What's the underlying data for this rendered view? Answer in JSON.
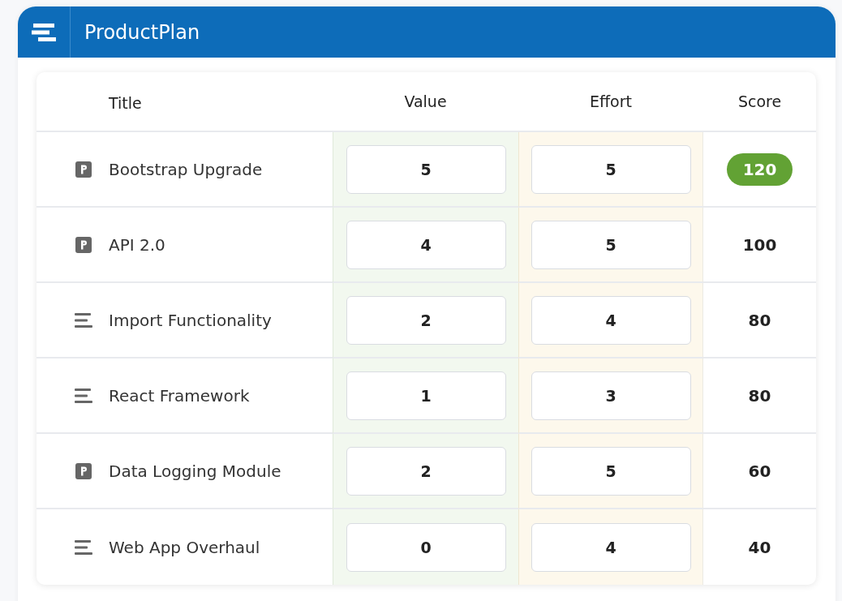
{
  "app": {
    "title": "ProductPlan"
  },
  "table": {
    "columns": [
      "Title",
      "Value",
      "Effort",
      "Score"
    ],
    "rows": [
      {
        "kind": "project",
        "title": "Bootstrap Upgrade",
        "value": "5",
        "effort": "5",
        "score": "120",
        "highlighted": true
      },
      {
        "kind": "project",
        "title": "API 2.0",
        "value": "4",
        "effort": "5",
        "score": "100",
        "highlighted": false
      },
      {
        "kind": "idea",
        "title": "Import Functionality",
        "value": "2",
        "effort": "4",
        "score": "80",
        "highlighted": false
      },
      {
        "kind": "idea",
        "title": "React Framework",
        "value": "1",
        "effort": "3",
        "score": "80",
        "highlighted": false
      },
      {
        "kind": "project",
        "title": "Data Logging Module",
        "value": "2",
        "effort": "5",
        "score": "60",
        "highlighted": false
      },
      {
        "kind": "idea",
        "title": "Web App Overhaul",
        "value": "0",
        "effort": "4",
        "score": "40",
        "highlighted": false
      }
    ]
  }
}
